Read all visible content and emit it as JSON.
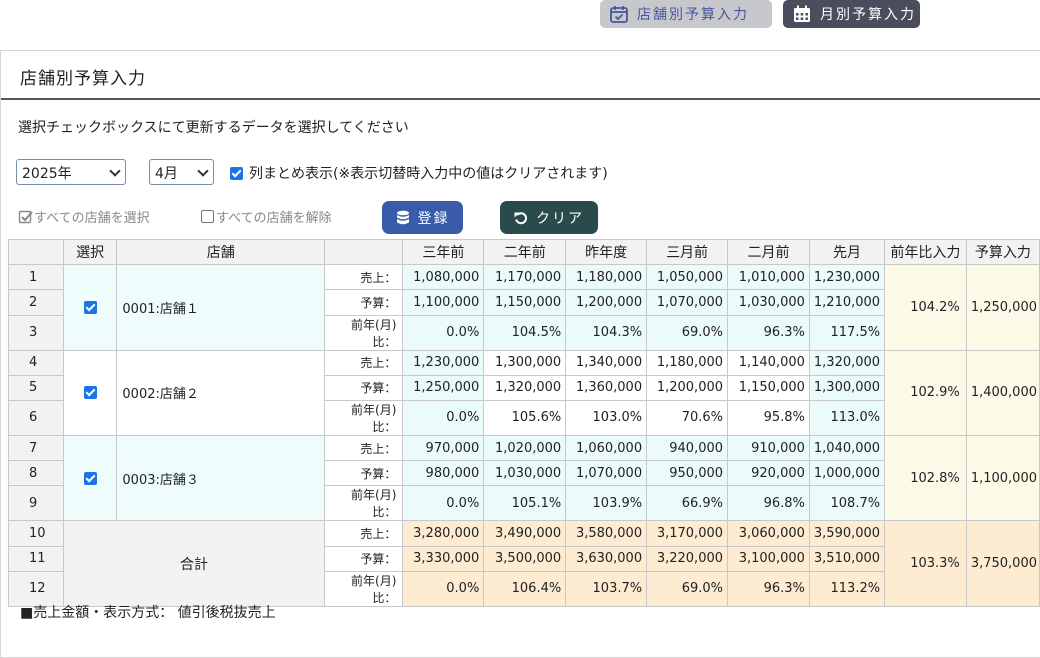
{
  "topbar": {
    "store_budget_label": "店舗別予算入力",
    "month_budget_label": "月別予算入力"
  },
  "panel": {
    "title": "店舗別予算入力",
    "instruction": "選択チェックボックスにて更新するデータを選択してください"
  },
  "controls": {
    "year": "2025年",
    "month": "4月",
    "group_display_label": "列まとめ表示(※表示切替時入力中の値はクリアされます)",
    "select_all_label": "すべての店舗を選択",
    "deselect_all_label": "すべての店舗を解除",
    "register_label": "登録",
    "clear_label": "クリア"
  },
  "table": {
    "headers": [
      "選択",
      "店舗",
      "三年前",
      "二年前",
      "昨年度",
      "三月前",
      "二月前",
      "先月",
      "前年比入力",
      "予算入力"
    ],
    "row_labels": [
      "売上：",
      "予算：",
      "前年(月)比："
    ],
    "stores": [
      {
        "name": "0001:店舗１",
        "selected": true,
        "rows": [
          {
            "no": "1",
            "values": [
              "1,080,000",
              "1,170,000",
              "1,180,000",
              "1,050,000",
              "1,010,000",
              "1,230,000"
            ]
          },
          {
            "no": "2",
            "values": [
              "1,100,000",
              "1,150,000",
              "1,200,000",
              "1,070,000",
              "1,030,000",
              "1,210,000"
            ]
          },
          {
            "no": "3",
            "values": [
              "0.0%",
              "104.5%",
              "104.3%",
              "69.0%",
              "96.3%",
              "117.5%"
            ]
          }
        ],
        "yoy_input": "104.2%",
        "budget_input": "1,250,000"
      },
      {
        "name": "0002:店舗２",
        "selected": true,
        "rows": [
          {
            "no": "4",
            "values": [
              "1,230,000",
              "1,300,000",
              "1,340,000",
              "1,180,000",
              "1,140,000",
              "1,320,000"
            ]
          },
          {
            "no": "5",
            "values": [
              "1,250,000",
              "1,320,000",
              "1,360,000",
              "1,200,000",
              "1,150,000",
              "1,300,000"
            ]
          },
          {
            "no": "6",
            "values": [
              "0.0%",
              "105.6%",
              "103.0%",
              "70.6%",
              "95.8%",
              "113.0%"
            ]
          }
        ],
        "yoy_input": "102.9%",
        "budget_input": "1,400,000"
      },
      {
        "name": "0003:店舗３",
        "selected": true,
        "rows": [
          {
            "no": "7",
            "values": [
              "970,000",
              "1,020,000",
              "1,060,000",
              "940,000",
              "910,000",
              "1,040,000"
            ]
          },
          {
            "no": "8",
            "values": [
              "980,000",
              "1,030,000",
              "1,070,000",
              "950,000",
              "920,000",
              "1,000,000"
            ]
          },
          {
            "no": "9",
            "values": [
              "0.0%",
              "105.1%",
              "103.9%",
              "66.9%",
              "96.8%",
              "108.7%"
            ]
          }
        ],
        "yoy_input": "102.8%",
        "budget_input": "1,100,000"
      }
    ],
    "total": {
      "label": "合計",
      "rows": [
        {
          "no": "10",
          "values": [
            "3,280,000",
            "3,490,000",
            "3,580,000",
            "3,170,000",
            "3,060,000",
            "3,590,000"
          ]
        },
        {
          "no": "11",
          "values": [
            "3,330,000",
            "3,500,000",
            "3,630,000",
            "3,220,000",
            "3,100,000",
            "3,510,000"
          ]
        },
        {
          "no": "12",
          "values": [
            "0.0%",
            "106.4%",
            "103.7%",
            "69.0%",
            "96.3%",
            "113.2%"
          ]
        }
      ],
      "yoy_input": "103.3%",
      "budget_input": "3,750,000"
    }
  },
  "footer": {
    "note": "■売上金額・表示方式： 値引後税抜売上"
  },
  "colors": {
    "store_button_bg": "#c7c8cc",
    "month_button_bg": "#4a4d5c",
    "register_bg": "#3a5ba9",
    "clear_bg": "#2b4a4c",
    "total_bg": "#fdebd2",
    "input_bg": "#fdfbe8",
    "selected_row_bg": "#effcfc"
  }
}
